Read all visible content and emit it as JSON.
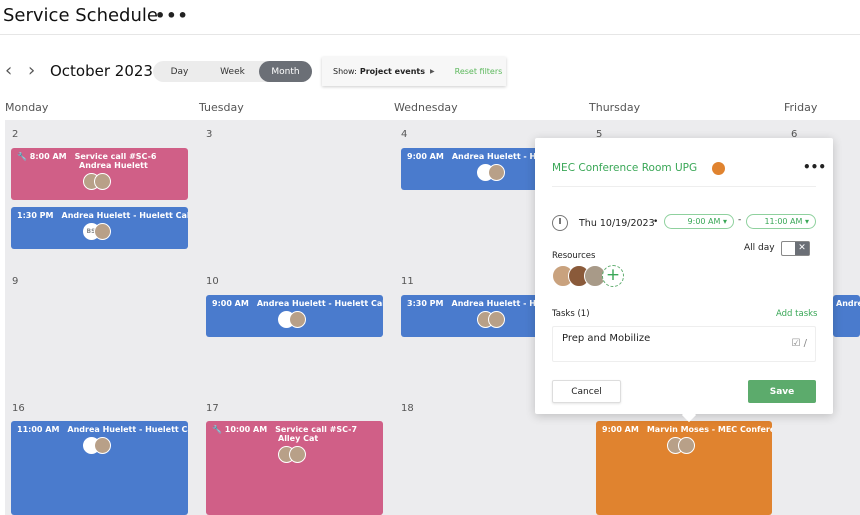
{
  "header": {
    "title": "Service Schedule",
    "more": "•••"
  },
  "toolbar": {
    "prev": "‹",
    "next": "›",
    "month": "October 2023",
    "views": [
      "Day",
      "Week",
      "Month"
    ],
    "active_view": "Month",
    "show_label": "Show:",
    "show_value": "Project events",
    "reset": "Reset filters"
  },
  "days": [
    "Monday",
    "Tuesday",
    "Wednesday",
    "Thursday",
    "Friday"
  ],
  "weeks": [
    [
      "2",
      "3",
      "4",
      "5",
      "6"
    ],
    [
      "9",
      "10",
      "11"
    ],
    [
      "16",
      "17",
      "18"
    ]
  ],
  "events": [
    {
      "time": "8:00 AM",
      "title": "Service call #SC-6",
      "sub": "Andrea Huelett",
      "color": "pink",
      "icon": "wrench-icon"
    },
    {
      "time": "1:30 PM",
      "title": "Andrea Huelett - Huelett Cabi...",
      "initials": "BS",
      "color": "blue"
    },
    {
      "time": "9:00 AM",
      "title": "Andrea Huelett - Hu",
      "color": "blue"
    },
    {
      "time": "9:00 AM",
      "title": "Andrea Huelett - Huelett Cab...",
      "color": "blue"
    },
    {
      "time": "3:30 PM",
      "title": "Andrea Huelett - Hue",
      "color": "blue"
    },
    {
      "time": "",
      "title": "Andre",
      "color": "blue"
    },
    {
      "time": "11:00 AM",
      "title": "Andrea Huelett - Huelett Ca...",
      "color": "blue"
    },
    {
      "time": "10:00 AM",
      "title": "Service call #SC-7",
      "sub": "Alley Cat",
      "color": "pink",
      "icon": "wrench-icon"
    },
    {
      "time": "9:00 AM",
      "title": "Marvin Moses - MEC Confere...",
      "color": "orange"
    }
  ],
  "popup": {
    "title": "MEC Conference Room UPG",
    "color": "#e0832f",
    "more": "•••",
    "date": "Thu 10/19/2023",
    "start": "9:00 AM",
    "end": "11:00 AM",
    "allday": "All day",
    "allday_on": false,
    "resources": "Resources",
    "tasks_label": "Tasks (1)",
    "add_tasks": "Add tasks",
    "task": "Prep and Mobilize",
    "cancel": "Cancel",
    "save": "Save"
  },
  "colors": {
    "blue": "#4a7bcd",
    "pink": "#d05f87",
    "orange": "#e0832f",
    "green": "#5cab6c"
  }
}
